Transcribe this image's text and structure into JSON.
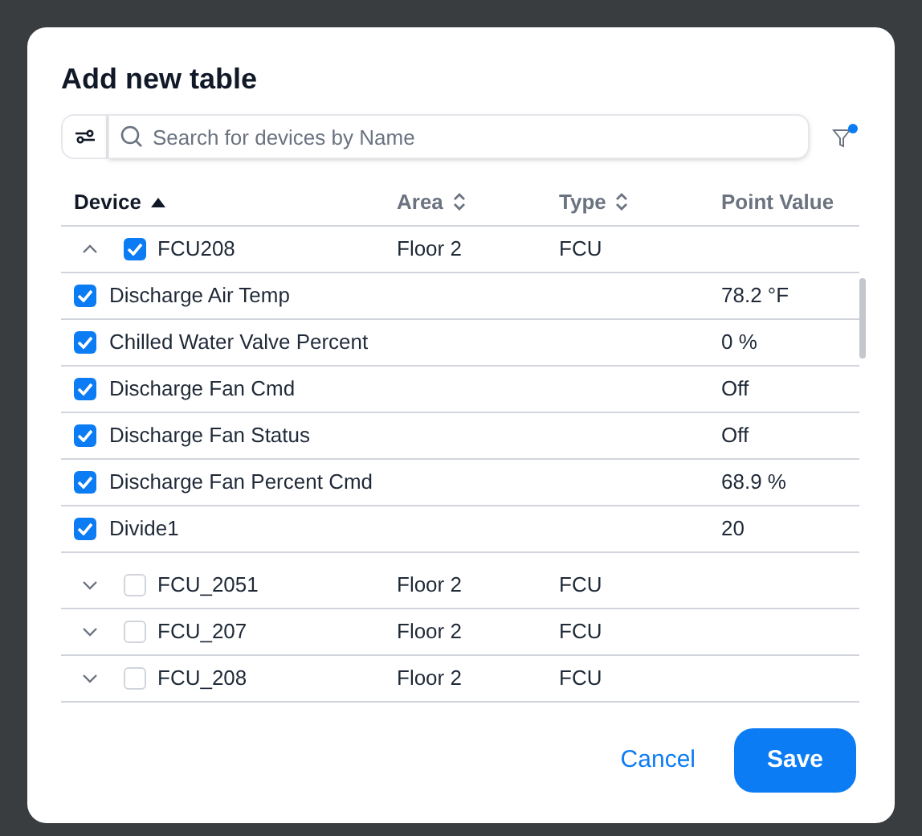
{
  "dialog": {
    "title": "Add new table"
  },
  "search": {
    "placeholder": "Search for devices by Name"
  },
  "filter": {
    "active": true
  },
  "table": {
    "columns": [
      {
        "label": "Device",
        "sorted": true,
        "sortable": true
      },
      {
        "label": "Area",
        "sorted": false,
        "sortable": true
      },
      {
        "label": "Type",
        "sorted": false,
        "sortable": true
      },
      {
        "label": "Point Value",
        "sorted": false
      }
    ],
    "rows": [
      {
        "device": "FCU208",
        "area": "Floor 2",
        "type": "FCU",
        "checked": true,
        "expanded": true,
        "children": [
          {
            "name": "Discharge Air Temp",
            "value": "78.2 °F",
            "checked": true
          },
          {
            "name": "Chilled Water Valve Percent",
            "value": "0 %",
            "checked": true
          },
          {
            "name": "Discharge Fan Cmd",
            "value": "Off",
            "checked": true
          },
          {
            "name": "Discharge Fan Status",
            "value": "Off",
            "checked": true
          },
          {
            "name": "Discharge Fan Percent Cmd",
            "value": "68.9 %",
            "checked": true
          },
          {
            "name": "Divide1",
            "value": "20",
            "checked": true
          }
        ]
      },
      {
        "device": "FCU_2051",
        "area": "Floor 2",
        "type": "FCU",
        "checked": false,
        "expanded": false
      },
      {
        "device": "FCU_207",
        "area": "Floor 2",
        "type": "FCU",
        "checked": false,
        "expanded": false
      },
      {
        "device": "FCU_208",
        "area": "Floor 2",
        "type": "FCU",
        "checked": false,
        "expanded": false
      }
    ]
  },
  "buttons": [
    {
      "label": "Cancel",
      "kind": "text"
    },
    {
      "label": "Save",
      "kind": "primary"
    }
  ]
}
